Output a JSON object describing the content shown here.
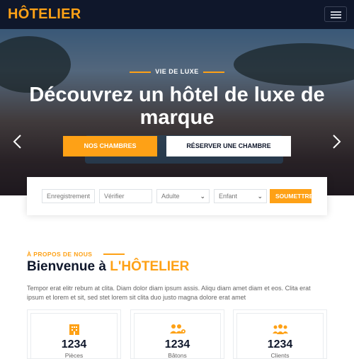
{
  "navbar": {
    "brand": "HÔTELIER",
    "menu_icon": "hamburger-icon"
  },
  "hero": {
    "eyebrow": "VIE DE LUXE",
    "title": "Découvrez un hôtel de luxe de marque",
    "primary_button": "NOS CHAMBRES",
    "secondary_button": "RÉSERVER UNE CHAMBRE",
    "prev_icon": "chevron-left-icon",
    "next_icon": "chevron-right-icon"
  },
  "booking": {
    "checkin_placeholder": "Enregistrement",
    "checkout_placeholder": "Vérifier",
    "adult_value": "Adulte",
    "child_value": "Enfant",
    "submit_label": "SOUMETTRE"
  },
  "about": {
    "eyebrow": "À PROPOS DE NOUS",
    "title_prefix": "Bienvenue à ",
    "title_brand": "L'HÔTELIER",
    "text": "Tempor erat elitr rebum at clita. Diam dolor diam ipsum assis. Aliqu diam amet diam et eos. Clita erat ipsum et lorem et sit, sed stet lorem sit clita duo justo magna dolore erat amet"
  },
  "stats": [
    {
      "icon": "hotel-icon",
      "value": "1234",
      "label": "Pièces"
    },
    {
      "icon": "users-cog-icon",
      "value": "1234",
      "label": "Bâtons"
    },
    {
      "icon": "users-icon",
      "value": "1234",
      "label": "Clients"
    }
  ],
  "colors": {
    "accent": "#fea116",
    "dark": "#0f172b"
  }
}
